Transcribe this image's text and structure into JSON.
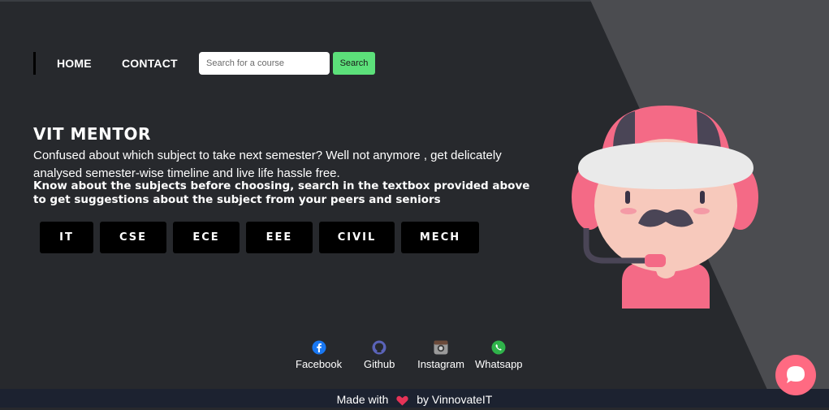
{
  "nav": {
    "home_label": "HOME",
    "contact_label": "CONTACT",
    "search_placeholder": "Search for a course",
    "search_button_label": "Search"
  },
  "hero": {
    "title": "VIT MENTOR",
    "description": "Confused about which subject to take next semester? Well not anymore , get delicately analysed semester-wise timeline and live life hassle free.",
    "instructions": "Know about the subjects before choosing, search in the textbox provided above to get suggestions about the subject from your peers and seniors"
  },
  "subjects": [
    "IT",
    "CSE",
    "ECE",
    "EEE",
    "CIVIL",
    "MECH"
  ],
  "socials": [
    {
      "label": "Facebook",
      "icon": "facebook-icon"
    },
    {
      "label": "Github",
      "icon": "github-icon"
    },
    {
      "label": "Instagram",
      "icon": "instagram-icon"
    },
    {
      "label": "Whatsapp",
      "icon": "whatsapp-icon"
    }
  ],
  "footer": {
    "made_with": "Made with",
    "by": "by VinnovateIT",
    "icon": "heart-icon"
  },
  "chat": {
    "icon": "chat-bubble-icon"
  },
  "colors": {
    "background": "#27292d",
    "diagonal_panel": "#4b4c50",
    "search_button": "#5ce07a",
    "chat_button": "#ff6a82",
    "footer_bar": "#1c2230"
  }
}
